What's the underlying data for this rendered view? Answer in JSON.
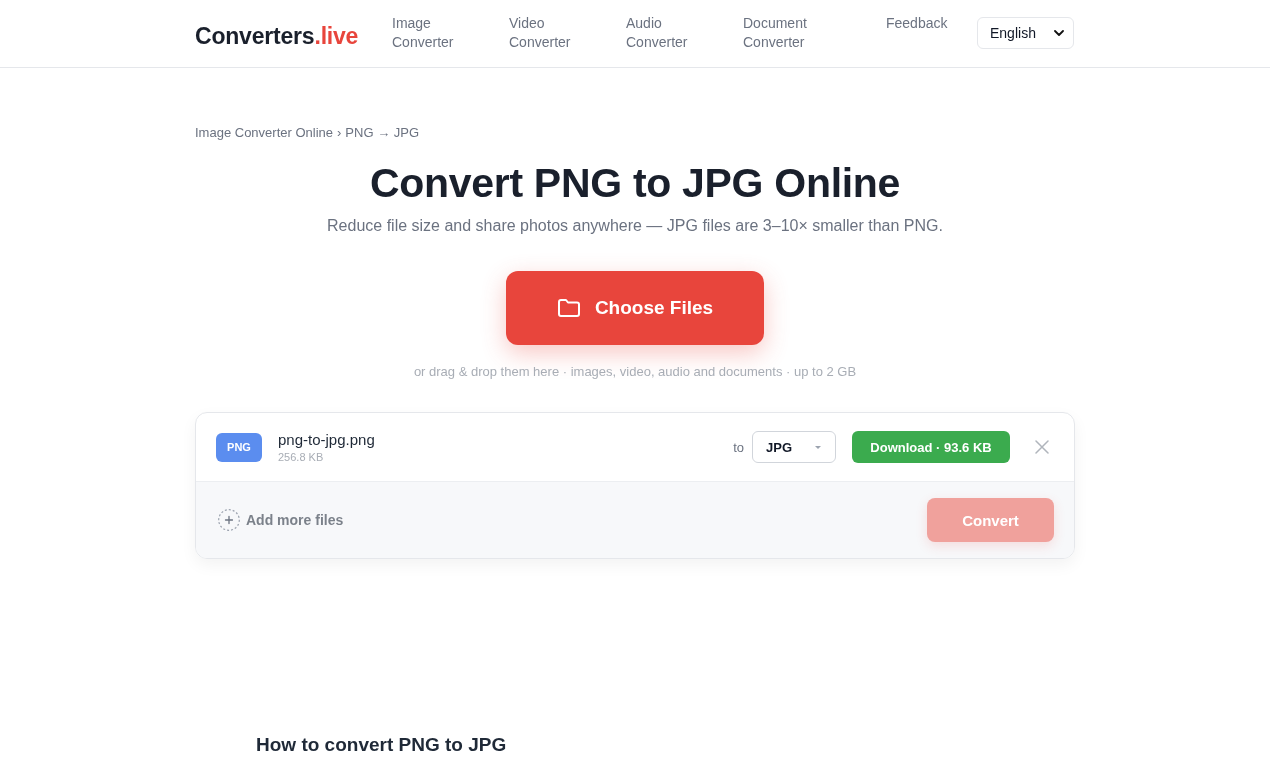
{
  "header": {
    "logo": {
      "name": "Converters",
      "suffix": ".live"
    },
    "nav": [
      {
        "label": "Image Converter"
      },
      {
        "label": "Video Converter"
      },
      {
        "label": "Audio Converter"
      },
      {
        "label": "Document Converter"
      },
      {
        "label": "Feedback"
      }
    ],
    "language": "English"
  },
  "breadcrumb": {
    "items": [
      {
        "label": "Image Converter Online"
      },
      {
        "label": "PNG → JPG"
      }
    ],
    "separator": "›"
  },
  "title": "Convert PNG to JPG Online",
  "subtitle": "Reduce file size and share photos anywhere — JPG files are 3–10× smaller than PNG.",
  "upload": {
    "button": "Choose Files",
    "hint": "or drag & drop them here · images, video, audio and documents · up to 2 GB"
  },
  "files": [
    {
      "type": "PNG",
      "name": "png-to-jpg.png",
      "size": "256.8 KB",
      "to_label": "to",
      "format": "JPG",
      "download": "Download · 93.6 KB"
    }
  ],
  "add_more": "Add more files",
  "convert": {
    "label": "Convert",
    "disabled": true
  },
  "section_heading": "How to convert PNG to JPG"
}
